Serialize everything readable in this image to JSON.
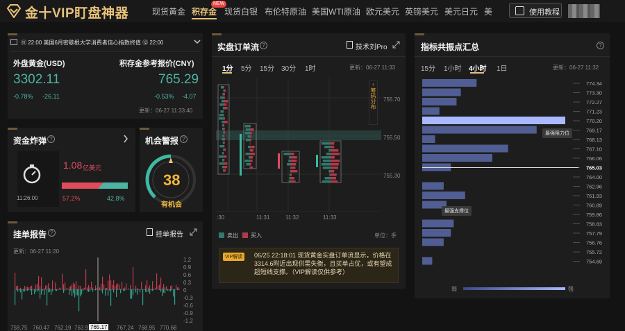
{
  "header": {
    "logo": "金十VIP盯盘神器",
    "nav": [
      "现货黄金",
      "积存金",
      "现货白银",
      "布伦特原油",
      "美国WTI原油",
      "欧元美元",
      "英镑美元",
      "美元日元",
      "美"
    ],
    "new_badge": "NEW",
    "tutorial": "使用教程"
  },
  "ticker": {
    "text": "⑪ 22:00 美国6月密歇根大学消费者信心指数终值 ⑫ 22:00"
  },
  "prices": {
    "left_name": "外盘黄金(USD)",
    "left_price": "3302.11",
    "left_pct": "-0.78%",
    "left_chg": "-26.11",
    "right_name": "积存金参考报价(CNY)",
    "right_price": "765.29",
    "right_pct": "-0.53%",
    "right_chg": "-4.07",
    "updated": "更新：06-27 11:33:40"
  },
  "bomb": {
    "title": "资金炸弹",
    "time": "11:26:00",
    "amount": "1.08",
    "unit": "亿美元",
    "left_pct": "57.2%",
    "right_pct": "42.8%"
  },
  "alert": {
    "title": "机会警报",
    "value": "38",
    "label": "有机会"
  },
  "orders": {
    "title": "挂单报告",
    "report": "挂单报告",
    "updated": "更新：06-27 11:20",
    "yaxis": [
      "1.2",
      "0.9",
      "0.6",
      "0.3",
      "0",
      "-0.3",
      "-0.6",
      "-0.9",
      "-1.2"
    ],
    "xaxis": [
      "758.75",
      "760.47",
      "762.19",
      "763.91",
      "765.17",
      "767.24",
      "768.95",
      "770.68"
    ]
  },
  "flow": {
    "title": "实盘订单流",
    "pro": "技术刘Pro",
    "tabs": [
      "1分",
      "5分",
      "15分",
      "30分",
      "1时"
    ],
    "updated": "更新：06-27 11:33",
    "yaxis": [
      "755.70",
      "755.50",
      "755.30",
      "755.30"
    ],
    "xaxis": [
      ":30",
      "11:31",
      "11:32",
      "11:33"
    ],
    "side_label": "筹码分布",
    "legend_sell": "卖出",
    "legend_buy": "买入",
    "unit": "单位：手",
    "vip_tag": "VIP解读",
    "vip_text": "06/25 22:18:01 现货黄金实盘订单流显示，价格在3314.6附近出现供需失衡，且买单占优，或有望成超短线支撑。（VIP解读仅供参考）"
  },
  "pivot": {
    "title": "指标共振点汇总",
    "tabs": [
      "15分",
      "1小时",
      "4小时",
      "1日"
    ],
    "updated": "更新：06-27 11:32",
    "levels": [
      "774.34",
      "773.30",
      "772.27",
      "771.23",
      "770.20",
      "769.17",
      "768.13",
      "767.10",
      "766.06",
      "765.03",
      "764.00",
      "762.96",
      "761.93",
      "760.89",
      "759.86",
      "758.83",
      "757.79",
      "756.76",
      "755.72",
      "754.69"
    ],
    "bars": [
      0.38,
      0.27,
      0.24,
      0.12,
      1.0,
      0.8,
      0.09,
      0.6,
      0.49,
      0.2,
      0,
      0.15,
      0.3,
      0.17,
      0,
      0.22,
      0.2,
      0.15,
      0,
      0.07
    ],
    "tip_resist": "最强阻力位",
    "tip_support": "最强支撑位",
    "weak": "弱",
    "strong": "强",
    "current": "765.03"
  },
  "colors": {
    "gold": "#e8c27a",
    "green": "#4db3a3",
    "red": "#e04b5a",
    "bar": "#5b6aa8",
    "bar_hi": "#aab8ff"
  }
}
